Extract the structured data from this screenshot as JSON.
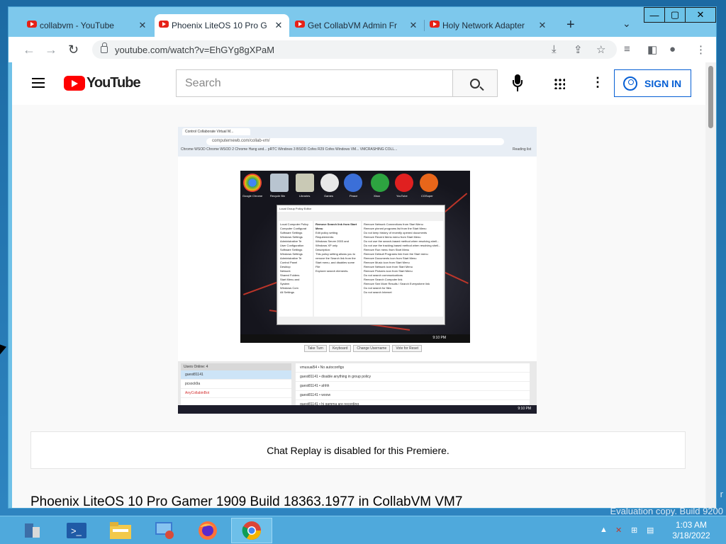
{
  "browser": {
    "tabs": [
      {
        "label": "collabvm - YouTube",
        "close": "✕"
      },
      {
        "label": "Phoenix LiteOS 10 Pro G",
        "close": "✕"
      },
      {
        "label": "Get CollabVM Admin Fr",
        "close": "✕"
      },
      {
        "label": "Holy Network Adapter",
        "close": "✕"
      }
    ],
    "new_tab": "+",
    "tab_search": "⌄",
    "window_controls": {
      "minimize": "—",
      "maximize": "▢",
      "close": "✕"
    },
    "nav": {
      "back": "←",
      "forward": "→",
      "reload": "↻"
    },
    "url": "youtube.com/watch?v=EhGYg8gXPaM",
    "toolbar_icons": [
      "install-icon",
      "share-icon",
      "bookmark-star-icon",
      "reading-list-icon",
      "side-panel-icon",
      "profile-icon",
      "menu-icon"
    ]
  },
  "youtube": {
    "logo_text": "YouTube",
    "search_placeholder": "Search",
    "sign_in": "SIGN IN",
    "more": "⋮",
    "chat_replay": "Chat Replay is disabled for this Premiere.",
    "video_title": "Phoenix LiteOS 10 Pro Gamer 1909 Build 18363.1977 in CollabVM VM7"
  },
  "video_frame": {
    "inner_tab": "Control Collaborate Virtual M...",
    "inner_url": "computernewb.com/collab-vm/",
    "bookmarks": "Chrome WSOD   Chrome WSOD 2   Chrome Hang and...   pRTC   Windows 3 BSOD   Cofes R29   Cofes Windows VM...   VMCRASHING COLL...",
    "reading_list": "Reading list",
    "desktop_icons": [
      "Google Chrome",
      "Recycle Bin",
      "Libraries",
      "Games",
      "Peace",
      "Xbox",
      "YouTube",
      "CGSuper"
    ],
    "dialog_title": "Local Group Policy Editor",
    "tree_items": [
      "Local Computer Policy",
      "Computer Configurat",
      "Software Settings",
      "Windows Settings",
      "Administrative Te",
      "User Configuration",
      "Software Settings",
      "Windows Settings",
      "Administrative Te",
      "Control Panel",
      "Desktop",
      "Network",
      "Shared Folders",
      "Start Menu and",
      "System",
      "Windows Com",
      "All Settings"
    ],
    "desc_title": "Remove Search link from Start Menu",
    "desc_lines": [
      "Edit policy setting",
      "Requirements:",
      "Windows Server 2003 and",
      "Windows XP only",
      "Description:",
      "This policy setting allows you to",
      "remove the Search link from the",
      "Start menu, and disables some File",
      "Explorer search elements."
    ],
    "list_items": [
      "Remove Network Connections from Start Menu",
      "Remove pinned programs list from the Start Menu",
      "Do not keep history of recently opened documents",
      "Remove Recent Items menu from Start Menu",
      "Do not use the search-based method when resolving shell...",
      "Do not use the tracking-based method when resolving shell...",
      "Remove Run menu from Start Menu",
      "Remove Default Programs link from the Start menu",
      "Remove Documents icon from Start Menu",
      "Remove Music icon from Start Menu",
      "Remove Network icon from Start Menu",
      "Remove Pictures icon from Start Menu",
      "Do not search communications",
      "Remove Search Computer link",
      "Remove See More Results / Search Everywhere link",
      "Do not search for files",
      "Do not search Internet"
    ],
    "vm_controls": [
      "Take Turn",
      "Keyboard",
      "Change Username",
      "Vote for Reset"
    ],
    "users_header": "Users Online: 4",
    "users": [
      "guest81141",
      "pcsock9a",
      "AnyCollabinBot"
    ],
    "chat": [
      "vmusual54 • No autoconfigs",
      "guest81141 • disable anything in group policy",
      "guest81141 • ahhh",
      "guest81141 • woow",
      "guest81141 • hi gamma are recording"
    ],
    "clock": "9:10 PM"
  },
  "watermark": {
    "line1": "r",
    "line2": "Evaluation copy. Build 9200"
  },
  "taskbar": {
    "apps": [
      "server-manager-icon",
      "powershell-icon",
      "file-explorer-icon",
      "control-panel-icon",
      "firefox-icon",
      "chrome-icon"
    ],
    "time": "1:03 AM",
    "date": "3/18/2022",
    "tray": [
      "show-hidden-icon",
      "volume-muted-icon",
      "network-icon",
      "action-center-icon"
    ]
  },
  "colors": {
    "youtube_red": "#ff0000",
    "signin_blue": "#065fd4",
    "taskbar": "#4fa9dc"
  }
}
